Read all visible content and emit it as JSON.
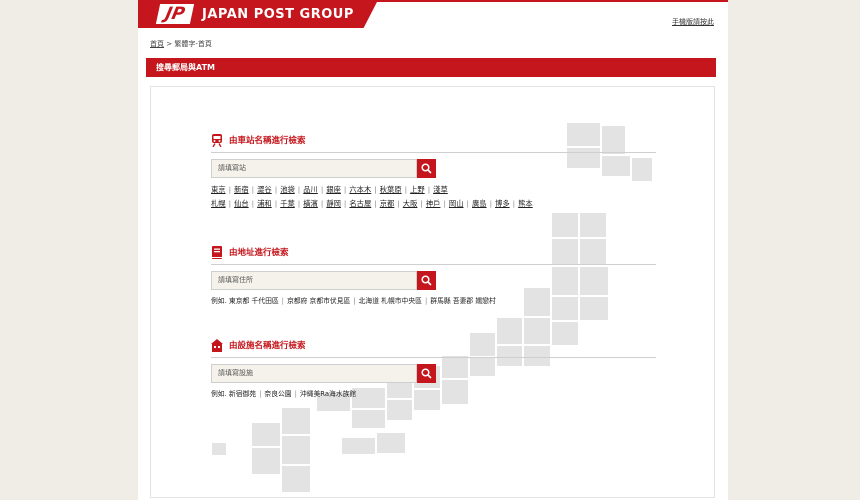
{
  "header": {
    "logo_mark": "JP",
    "logo_text": "JAPAN POST GROUP",
    "mobile_link": "手機版請按此",
    "brand_color": "#c4161c"
  },
  "breadcrumb": {
    "home": "首頁",
    "separator": ">",
    "current": "繁體字-首頁"
  },
  "section_title": "搜尋郵局與ATM",
  "station_search": {
    "title": "由車站名稱進行檢索",
    "icon": "train-icon",
    "placeholder": "請填寫站",
    "links_row1": [
      "東京",
      "新宿",
      "澀谷",
      "池袋",
      "品川",
      "銀座",
      "六本木",
      "秋葉原",
      "上野",
      "淺草"
    ],
    "links_row2": [
      "札幌",
      "仙台",
      "浦和",
      "千葉",
      "橫濱",
      "靜岡",
      "名古屋",
      "京都",
      "大阪",
      "神戶",
      "岡山",
      "廣島",
      "博多",
      "熊本"
    ]
  },
  "address_search": {
    "title": "由地址進行檢索",
    "icon": "book-icon",
    "placeholder": "請填寫住所",
    "examples_prefix": "例如.",
    "examples": [
      "東京都 千代田區",
      "京都府 京都市伏見區",
      "北海道 札幌市中央區",
      "群馬縣 吾妻郡 嬬戀村"
    ]
  },
  "facility_search": {
    "title": "由設施名稱進行檢索",
    "icon": "building-icon",
    "placeholder": "請填寫設施",
    "examples_prefix": "例如.",
    "examples": [
      "新宿御苑",
      "奈良公園",
      "沖縄美Ra海水族館"
    ]
  }
}
